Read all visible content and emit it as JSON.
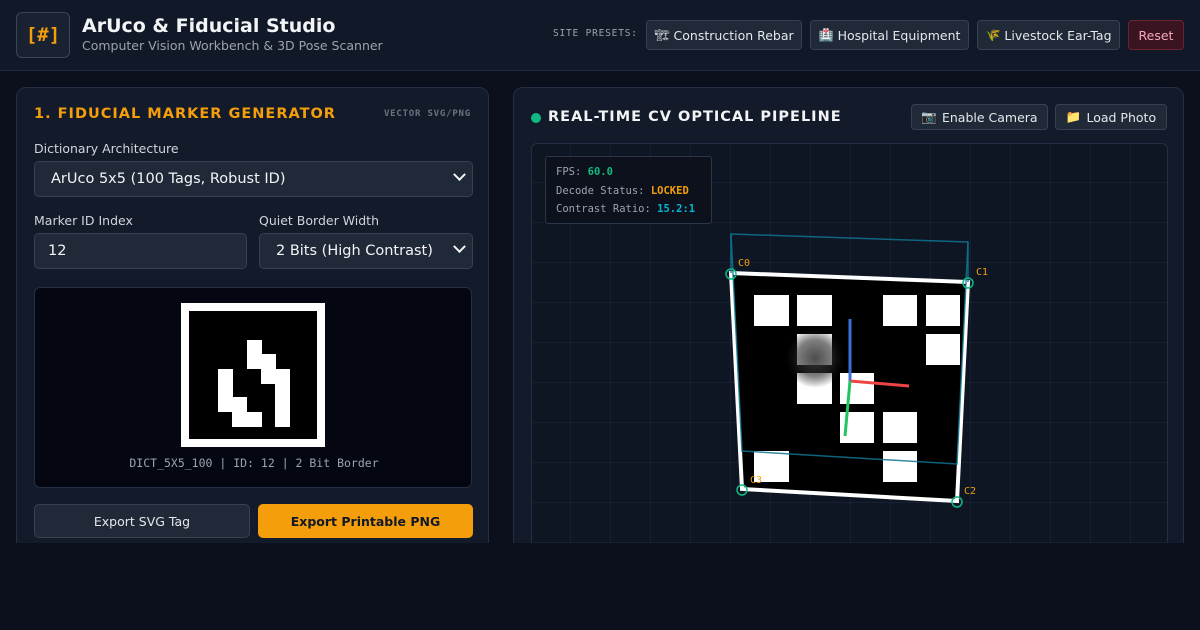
{
  "header": {
    "logo_text": "[#]",
    "title": "ArUco & Fiducial Studio",
    "subtitle": "Computer Vision Workbench & 3D Pose Scanner",
    "presets_label": "SITE PRESETS:",
    "presets": [
      {
        "icon": "🏗",
        "label": "Construction Rebar"
      },
      {
        "icon": "🏥",
        "label": "Hospital Equipment"
      },
      {
        "icon": "🌾",
        "label": "Livestock Ear-Tag"
      }
    ],
    "reset_label": "Reset"
  },
  "generator": {
    "title": "1. FIDUCIAL MARKER GENERATOR",
    "tag": "VECTOR SVG/PNG",
    "dictionary_label": "Dictionary Architecture",
    "dictionary_value": "ArUco 5x5 (100 Tags, Robust ID)",
    "marker_id_label": "Marker ID Index",
    "marker_id_value": "12",
    "border_label": "Quiet Border Width",
    "border_value": "2 Bits (High Contrast)",
    "caption": "DICT_5X5_100 | ID: 12 | 2 Bit Border",
    "export_svg_label": "Export SVG Tag",
    "export_png_label": "Export Printable PNG",
    "marker_cells": [
      [
        4,
        2
      ],
      [
        4,
        3
      ],
      [
        5,
        3
      ],
      [
        2,
        4
      ],
      [
        5,
        4
      ],
      [
        6,
        4
      ],
      [
        2,
        5
      ],
      [
        6,
        5
      ],
      [
        2,
        6
      ],
      [
        3,
        6
      ],
      [
        6,
        6
      ],
      [
        3,
        7
      ],
      [
        4,
        7
      ],
      [
        6,
        7
      ]
    ]
  },
  "pipeline": {
    "title": "REAL-TIME CV OPTICAL PIPELINE",
    "status_color": "#10b981",
    "camera_icon": "📷",
    "camera_label": "Enable Camera",
    "photo_icon": "📁",
    "photo_label": "Load Photo",
    "hud": {
      "fps_label": "FPS:",
      "fps_value": "60.0",
      "decode_label": "Decode Status:",
      "decode_value": "LOCKED",
      "contrast_label": "Contrast Ratio:",
      "contrast_value": "15.2:1"
    },
    "corner_labels": [
      "C0",
      "C1",
      "C2",
      "C3"
    ]
  }
}
